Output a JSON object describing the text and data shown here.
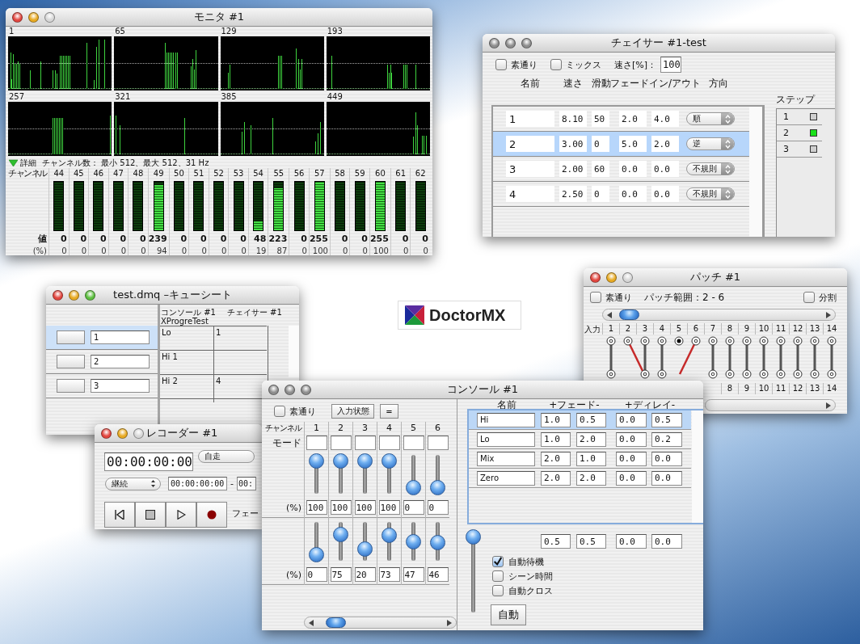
{
  "monitor": {
    "title": "モニタ #1",
    "active": true,
    "zoom_enabled": false,
    "graph_labels": [
      "1",
      "65",
      "129",
      "193",
      "257",
      "321",
      "385",
      "449"
    ],
    "details": {
      "expanded": true,
      "toggle": "詳細",
      "summary": "チャンネル数： 最小 512、最大 512、31 Hz"
    },
    "channel_label": "チャンネル",
    "value_label": "値",
    "percent_label": "(%)",
    "channels": [
      {
        "number": "44",
        "value": "0",
        "percent": "0",
        "level": 0
      },
      {
        "number": "45",
        "value": "0",
        "percent": "0",
        "level": 0
      },
      {
        "number": "46",
        "value": "0",
        "percent": "0",
        "level": 0
      },
      {
        "number": "47",
        "value": "0",
        "percent": "0",
        "level": 0
      },
      {
        "number": "48",
        "value": "0",
        "percent": "0",
        "level": 0
      },
      {
        "number": "49",
        "value": "239",
        "percent": "94",
        "level": 0.94
      },
      {
        "number": "50",
        "value": "0",
        "percent": "0",
        "level": 0
      },
      {
        "number": "51",
        "value": "0",
        "percent": "0",
        "level": 0
      },
      {
        "number": "52",
        "value": "0",
        "percent": "0",
        "level": 0
      },
      {
        "number": "53",
        "value": "0",
        "percent": "0",
        "level": 0
      },
      {
        "number": "54",
        "value": "48",
        "percent": "19",
        "level": 0.19
      },
      {
        "number": "55",
        "value": "223",
        "percent": "87",
        "level": 0.87
      },
      {
        "number": "56",
        "value": "0",
        "percent": "0",
        "level": 0
      },
      {
        "number": "57",
        "value": "255",
        "percent": "100",
        "level": 1
      },
      {
        "number": "58",
        "value": "0",
        "percent": "0",
        "level": 0
      },
      {
        "number": "59",
        "value": "0",
        "percent": "0",
        "level": 0
      },
      {
        "number": "60",
        "value": "255",
        "percent": "100",
        "level": 1
      },
      {
        "number": "61",
        "value": "0",
        "percent": "0",
        "level": 0
      },
      {
        "number": "62",
        "value": "0",
        "percent": "0",
        "level": 0
      }
    ]
  },
  "chaser": {
    "title": "チェイサー #1-test",
    "active": false,
    "options": [
      {
        "label": "素通り",
        "checked": false
      },
      {
        "label": "ミックス",
        "checked": false
      }
    ],
    "speed_label": "速さ[%]：",
    "speed_value": "100",
    "columns": [
      "名前",
      "速さ",
      "滑動",
      "フェードイン/アウト",
      "方向"
    ],
    "rows": [
      {
        "name": "1",
        "speed": "8.10",
        "slide": "50",
        "fade_in": "2.0",
        "fade_out": "4.0",
        "direction": "順",
        "selected": false
      },
      {
        "name": "2",
        "speed": "3.00",
        "slide": "0",
        "fade_in": "5.0",
        "fade_out": "2.0",
        "direction": "逆",
        "selected": true
      },
      {
        "name": "3",
        "speed": "2.00",
        "slide": "60",
        "fade_in": "0.0",
        "fade_out": "0.0",
        "direction": "不規則",
        "selected": false
      },
      {
        "name": "4",
        "speed": "2.50",
        "slide": "0",
        "fade_in": "0.0",
        "fade_out": "0.0",
        "direction": "不規則",
        "selected": false
      }
    ],
    "steps_label": "ステップ",
    "steps": [
      {
        "number": "1",
        "active": false
      },
      {
        "number": "2",
        "active": true
      },
      {
        "number": "3",
        "active": false
      }
    ]
  },
  "logo": {
    "text": "DoctorMX"
  },
  "cuesheet": {
    "title": "test.dmq –キューシート",
    "active": true,
    "zoom_enabled": true,
    "cues": [
      {
        "number": "1",
        "selected": true
      },
      {
        "number": "2",
        "selected": false
      },
      {
        "number": "3",
        "selected": false
      }
    ],
    "columns": [
      "コンソール #1",
      "チェイサー #1"
    ],
    "subtitle": "XProgreTest",
    "cells": [
      {
        "console": "Lo",
        "chaser": "1"
      },
      {
        "console": "Hi 1"
      },
      {
        "console": "Hi 2",
        "chaser": "4"
      }
    ]
  },
  "recorder": {
    "title": "レコーダー #1",
    "active": true,
    "zoom_enabled": false,
    "timecode": "00:00:00:00",
    "sync_mode": "自走",
    "play_mode": "継続",
    "range_start": "00:00:00:00",
    "range_separator": "-",
    "range_end": "00:",
    "buttons": [
      {
        "kind": "rewind"
      },
      {
        "kind": "stop"
      },
      {
        "kind": "play"
      },
      {
        "kind": "record"
      }
    ],
    "fade_label": "フェー"
  },
  "patch": {
    "title": "パッチ #1",
    "active": true,
    "zoom_enabled": false,
    "passthrough": {
      "label": "素通り",
      "checked": false
    },
    "range": "パッチ範囲：2 - 6",
    "split": {
      "label": "分割",
      "checked": false
    },
    "input_label": "入力",
    "inputs": [
      {
        "number": "1",
        "connected": true,
        "crossed": false
      },
      {
        "number": "2",
        "connected": true,
        "crossed": true
      },
      {
        "number": "3",
        "connected": true,
        "crossed": false
      },
      {
        "number": "4",
        "connected": true,
        "crossed": false
      },
      {
        "number": "5",
        "connected": false,
        "crossed": false
      },
      {
        "number": "6",
        "connected": true,
        "crossed": true
      },
      {
        "number": "7",
        "connected": true,
        "crossed": false
      },
      {
        "number": "8",
        "connected": true,
        "crossed": false
      },
      {
        "number": "9",
        "connected": true,
        "crossed": false
      },
      {
        "number": "10",
        "connected": true,
        "crossed": false
      },
      {
        "number": "11",
        "connected": true,
        "crossed": false
      },
      {
        "number": "12",
        "connected": true,
        "crossed": false
      },
      {
        "number": "13",
        "connected": true,
        "crossed": false
      },
      {
        "number": "14",
        "connected": true,
        "crossed": false
      }
    ],
    "outputs": [
      "8",
      "9",
      "10",
      "11",
      "12",
      "13",
      "14"
    ]
  },
  "console": {
    "title": "コンソール #1",
    "active": false,
    "passthrough": {
      "label": "素通り",
      "checked": false
    },
    "buttons": [
      "入力状態",
      "="
    ],
    "channel_label": "チャンネル",
    "mode_label": "モード",
    "upper_percent_label": "(%)",
    "lower_percent_label": "(%)",
    "channels": [
      {
        "number": "1",
        "upper": {
          "value": "100",
          "level": 1
        },
        "lower": {
          "value": "0",
          "level": 0
        }
      },
      {
        "number": "2",
        "upper": {
          "value": "100",
          "level": 1
        },
        "lower": {
          "value": "75",
          "level": 0.75
        }
      },
      {
        "number": "3",
        "upper": {
          "value": "100",
          "level": 1
        },
        "lower": {
          "value": "20",
          "level": 0.2
        }
      },
      {
        "number": "4",
        "upper": {
          "value": "100",
          "level": 1
        },
        "lower": {
          "value": "73",
          "level": 0.73
        }
      },
      {
        "number": "5",
        "upper": {
          "value": "0",
          "level": 0
        },
        "lower": {
          "value": "47",
          "level": 0.47
        }
      },
      {
        "number": "6",
        "upper": {
          "value": "0",
          "level": 0
        },
        "lower": {
          "value": "46",
          "level": 0.46
        }
      }
    ],
    "scene_columns": [
      "名前",
      "+フェード-",
      "+ディレイ-"
    ],
    "scenes": [
      {
        "name": "Hi",
        "fade_in": "1.0",
        "fade_out": "0.5",
        "delay_in": "0.0",
        "delay_out": "0.5",
        "selected": true
      },
      {
        "name": "Lo",
        "fade_in": "1.0",
        "fade_out": "2.0",
        "delay_in": "0.0",
        "delay_out": "0.2",
        "selected": false
      },
      {
        "name": "Mix",
        "fade_in": "2.0",
        "fade_out": "1.0",
        "delay_in": "0.0",
        "delay_out": "0.0",
        "selected": false
      },
      {
        "name": "Zero",
        "fade_in": "2.0",
        "fade_out": "2.0",
        "delay_in": "0.0",
        "delay_out": "0.0",
        "selected": false
      }
    ],
    "master": {
      "level": 1
    },
    "totals": [
      "0.5",
      "0.5",
      "0.0",
      "0.0"
    ],
    "options": [
      {
        "label": "自動待機",
        "checked": true
      },
      {
        "label": "シーン時間",
        "checked": false
      },
      {
        "label": "自動クロス",
        "checked": false
      }
    ],
    "auto_button": "自動"
  }
}
